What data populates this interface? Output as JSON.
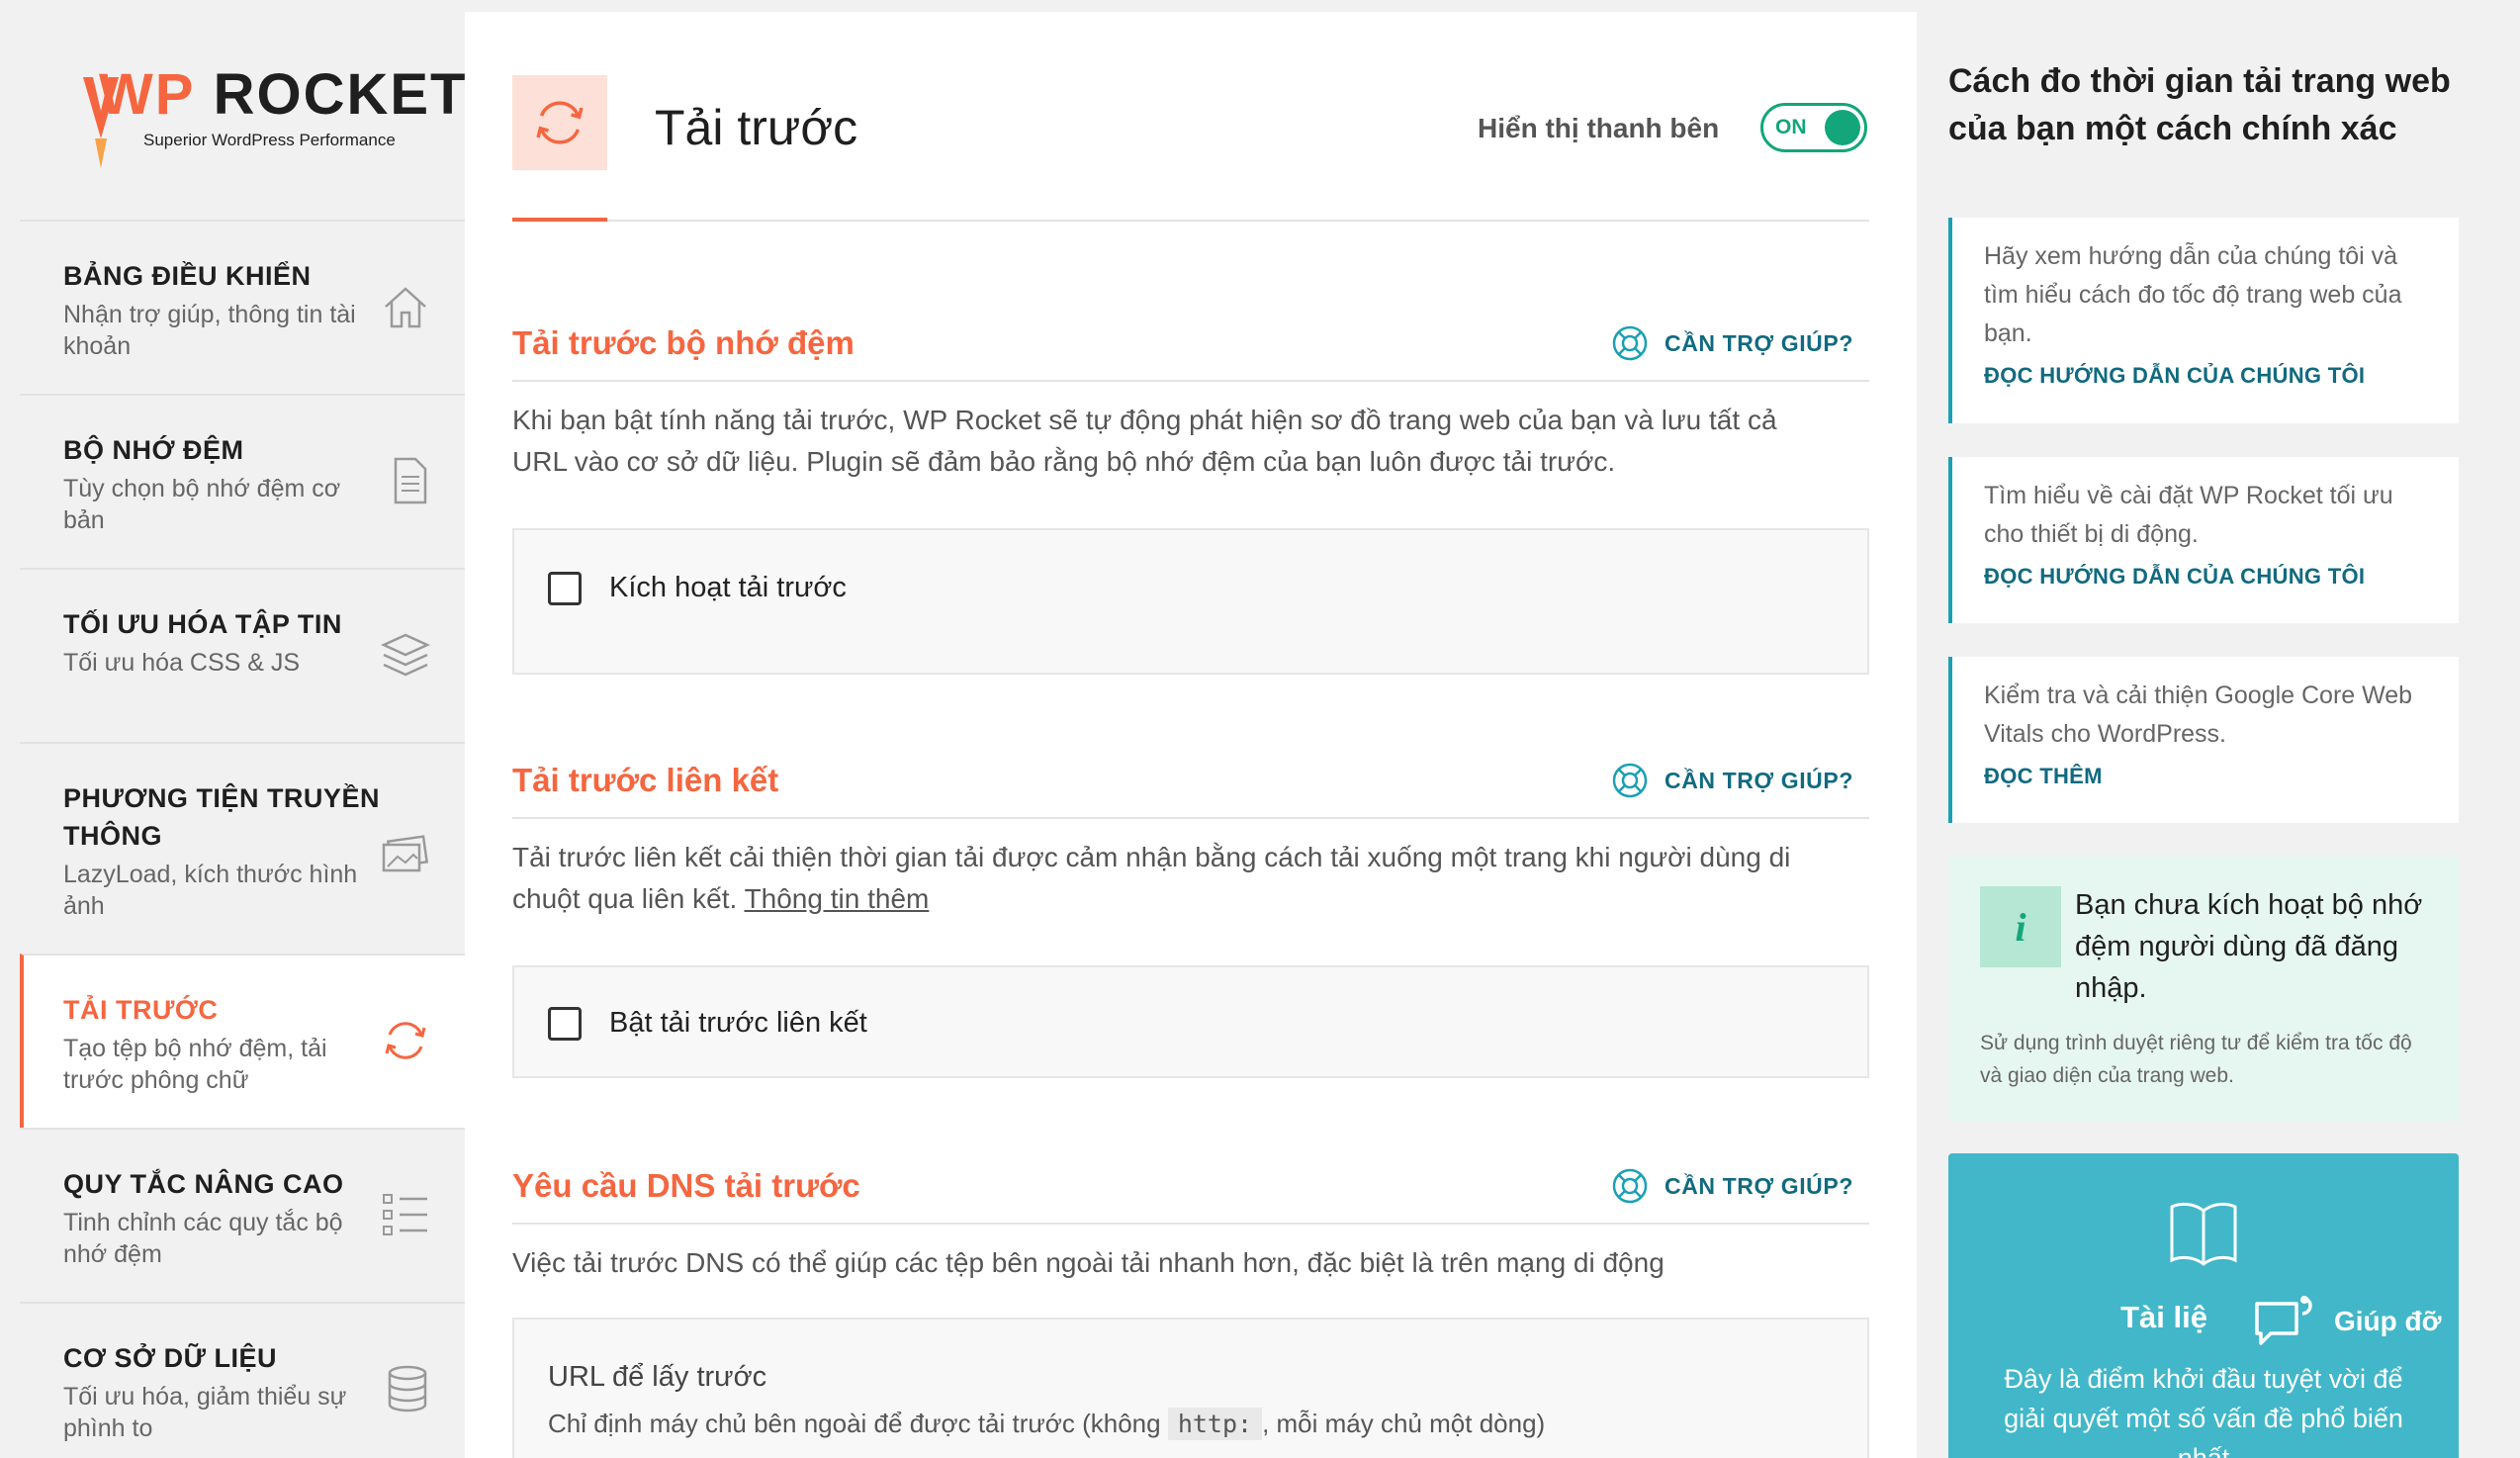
{
  "brand": {
    "name_part1": "WP",
    "name_part2": "ROCKET",
    "tagline": "Superior WordPress Performance"
  },
  "nav": {
    "items": [
      {
        "title": "BẢNG ĐIỀU KHIỂN",
        "subtitle": "Nhận trợ giúp, thông tin tài khoản",
        "icon": "home-icon"
      },
      {
        "title": "BỘ NHỚ ĐỆM",
        "subtitle": "Tùy chọn bộ nhớ đệm cơ bản",
        "icon": "file-icon"
      },
      {
        "title": "TỐI ƯU HÓA TẬP TIN",
        "subtitle": "Tối ưu hóa CSS & JS",
        "icon": "layers-icon"
      },
      {
        "title": "PHƯƠNG TIỆN TRUYỀN THÔNG",
        "subtitle": "LazyLoad, kích thước hình ảnh",
        "icon": "images-icon"
      },
      {
        "title": "TẢI TRƯỚC",
        "subtitle": "Tạo tệp bộ nhớ đệm, tải trước phông chữ",
        "icon": "refresh-icon"
      },
      {
        "title": "QUY TẮC NÂNG CAO",
        "subtitle": "Tinh chỉnh các quy tắc bộ nhớ đệm",
        "icon": "checklist-icon"
      },
      {
        "title": "CƠ SỞ DỮ LIỆU",
        "subtitle": "Tối ưu hóa, giảm thiểu sự phình to",
        "icon": "database-icon"
      }
    ]
  },
  "header": {
    "title": "Tải trước",
    "sidebar_toggle_label": "Hiển thị thanh bên",
    "toggle_state": "ON"
  },
  "sections": {
    "cache": {
      "title": "Tải trước bộ nhớ đệm",
      "help": "CẦN TRỢ GIÚP?",
      "description": "Khi bạn bật tính năng tải trước, WP Rocket sẽ tự động phát hiện sơ đồ trang web của bạn và lưu tất cả URL vào cơ sở dữ liệu. Plugin sẽ đảm bảo rằng bộ nhớ đệm của bạn luôn được tải trước.",
      "option": "Kích hoạt tải trước"
    },
    "links": {
      "title": "Tải trước liên kết",
      "help": "CẦN TRỢ GIÚP?",
      "description": "Tải trước liên kết cải thiện thời gian tải được cảm nhận bằng cách tải xuống một trang khi người dùng di chuột qua liên kết.",
      "more_link": "Thông tin thêm",
      "option": "Bật tải trước liên kết"
    },
    "dns": {
      "title": "Yêu cầu DNS tải trước",
      "help": "CẦN TRỢ GIÚP?",
      "description": "Việc tải trước DNS có thể giúp các tệp bên ngoài tải nhanh hơn, đặc biệt là trên mạng di động",
      "field_label": "URL để lấy trước",
      "field_desc_before": "Chỉ định máy chủ bên ngoài để được tải trước (không",
      "field_code": "http:",
      "field_desc_after": ", mỗi máy chủ một dòng)"
    }
  },
  "sidebar": {
    "title": "Cách đo thời gian tải trang web của bạn một cách chính xác",
    "cards": [
      {
        "text": "Hãy xem hướng dẫn của chúng tôi và tìm hiểu cách đo tốc độ trang web của bạn.",
        "link": "ĐỌC HƯỚNG DẪN CỦA CHÚNG TÔI"
      },
      {
        "text": "Tìm hiểu về cài đặt WP Rocket tối ưu cho thiết bị di động.",
        "link": "ĐỌC HƯỚNG DẪN CỦA CHÚNG TÔI"
      },
      {
        "text": "Kiểm tra và cải thiện Google Core Web Vitals cho WordPress.",
        "link": "ĐỌC THÊM"
      }
    ],
    "notice": {
      "icon_letter": "i",
      "title": "Bạn chưa kích hoạt bộ nhớ đệm người dùng đã đăng nhập.",
      "desc": "Sử dụng trình duyệt riêng tư để kiểm tra tốc độ và giao diện của trang web."
    },
    "docs": {
      "title": "Tài liệ",
      "desc": "Đây là điểm khởi đầu tuyệt vời để giải quyết một số vấn đề phổ biến nhất"
    },
    "help_button": "Giúp đỡ"
  },
  "colors": {
    "accent": "#f56640",
    "teal": "#116a80",
    "green": "#13a67a",
    "cyan": "#41b7c9"
  }
}
